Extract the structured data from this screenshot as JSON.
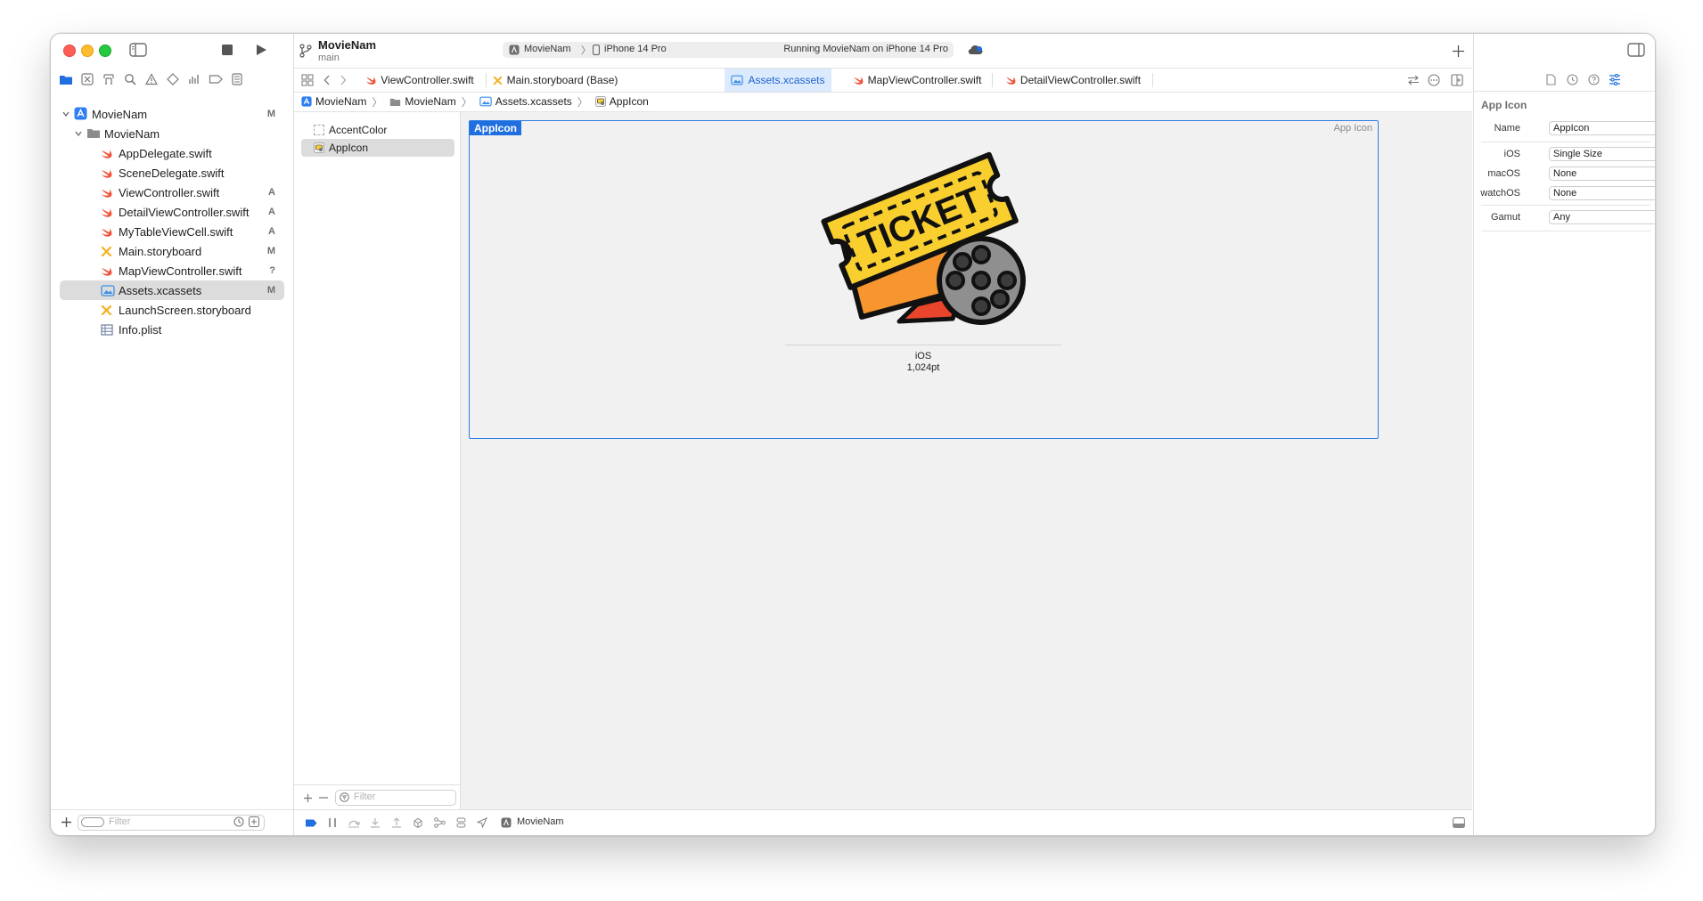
{
  "toolbar": {
    "project_name": "MovieNam",
    "branch": "main",
    "scheme": "MovieNam",
    "device": "iPhone 14 Pro",
    "run_status": "Running MovieNam on iPhone 14 Pro"
  },
  "tabs": [
    {
      "label": "ViewController.swift",
      "icon": "swift-icon"
    },
    {
      "label": "Main.storyboard (Base)",
      "icon": "storyboard-icon"
    },
    {
      "label": "Assets.xcassets",
      "icon": "assets-icon",
      "active": true
    },
    {
      "label": "MapViewController.swift",
      "icon": "swift-icon"
    },
    {
      "label": "DetailViewController.swift",
      "icon": "swift-icon"
    }
  ],
  "breadcrumb": [
    "MovieNam",
    "MovieNam",
    "Assets.xcassets",
    "AppIcon"
  ],
  "navigator": {
    "items": [
      {
        "label": "MovieNam",
        "badge": "M",
        "icon": "project-icon"
      },
      {
        "label": "MovieNam",
        "badge": "",
        "icon": "folder-icon"
      },
      {
        "label": "AppDelegate.swift",
        "badge": "",
        "icon": "swift-icon"
      },
      {
        "label": "SceneDelegate.swift",
        "badge": "",
        "icon": "swift-icon"
      },
      {
        "label": "ViewController.swift",
        "badge": "A",
        "icon": "swift-icon"
      },
      {
        "label": "DetailViewController.swift",
        "badge": "A",
        "icon": "swift-icon"
      },
      {
        "label": "MyTableViewCell.swift",
        "badge": "A",
        "icon": "swift-icon"
      },
      {
        "label": "Main.storyboard",
        "badge": "M",
        "icon": "storyboard-icon"
      },
      {
        "label": "MapViewController.swift",
        "badge": "?",
        "icon": "swift-icon"
      },
      {
        "label": "Assets.xcassets",
        "badge": "M",
        "icon": "assets-icon",
        "selected": true
      },
      {
        "label": "LaunchScreen.storyboard",
        "badge": "",
        "icon": "storyboard-icon"
      },
      {
        "label": "Info.plist",
        "badge": "",
        "icon": "plist-icon"
      }
    ],
    "filter_placeholder": "Filter"
  },
  "assets": {
    "items": [
      {
        "label": "AccentColor",
        "icon": "color-swatch-icon"
      },
      {
        "label": "AppIcon",
        "icon": "appicon-thumb-icon",
        "selected": true
      }
    ],
    "filter_placeholder": "Filter"
  },
  "canvas": {
    "set_name": "AppIcon",
    "set_kind": "App Icon",
    "slot_platform": "iOS",
    "slot_size": "1,024pt",
    "icon_text": "TICKET"
  },
  "statusbar": {
    "scheme": "MovieNam"
  },
  "inspector": {
    "section_title": "App Icon",
    "fields": [
      {
        "label": "Name",
        "value": "AppIcon",
        "control": "text"
      },
      {
        "label": "iOS",
        "value": "Single Size",
        "control": "popup"
      },
      {
        "label": "macOS",
        "value": "None",
        "control": "popup"
      },
      {
        "label": "watchOS",
        "value": "None",
        "control": "popup"
      },
      {
        "label": "Gamut",
        "value": "Any",
        "control": "popup"
      }
    ]
  },
  "colors": {
    "accent": "#1f6fe0",
    "swift": "#f05138",
    "storyboard": "#f2b01e",
    "ticket_yellow": "#f9cf2f",
    "ticket_orange": "#f7962f",
    "film_reel": "#8f8f8f"
  }
}
